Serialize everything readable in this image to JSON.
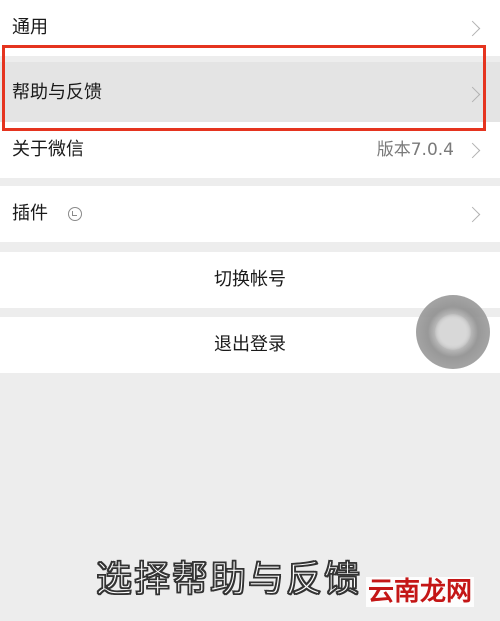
{
  "settings": {
    "general_label": "通用",
    "help_label": "帮助与反馈",
    "about_label": "关于微信",
    "about_value": "版本7.0.4",
    "plugins_label": "插件"
  },
  "actions": {
    "switch_account_label": "切换帐号",
    "logout_label": "退出登录"
  },
  "overlay": {
    "caption": "选择帮助与反馈",
    "watermark": "云南龙网",
    "highlight_color": "#e5341f"
  },
  "icons": {
    "chevron": "chevron-right-icon",
    "plugins": "plugin-badge-icon",
    "assistive_touch": "assistive-touch-icon"
  }
}
